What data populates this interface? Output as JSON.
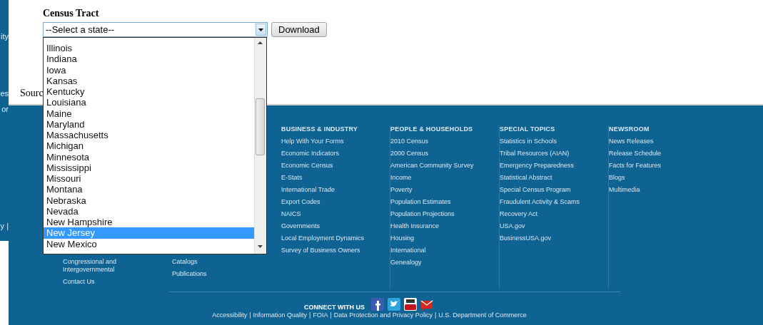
{
  "side_strip": [
    "ity",
    "es",
    "or",
    "y |"
  ],
  "heading": "Census Tract",
  "state_select": {
    "value": "--Select a state--",
    "expanded": true,
    "options": [
      {
        "label": "Illinois",
        "selected": false
      },
      {
        "label": "Indiana",
        "selected": false
      },
      {
        "label": "Iowa",
        "selected": false
      },
      {
        "label": "Kansas",
        "selected": false
      },
      {
        "label": "Kentucky",
        "selected": false
      },
      {
        "label": "Louisiana",
        "selected": false
      },
      {
        "label": "Maine",
        "selected": false
      },
      {
        "label": "Maryland",
        "selected": false
      },
      {
        "label": "Massachusetts",
        "selected": false
      },
      {
        "label": "Michigan",
        "selected": false
      },
      {
        "label": "Minnesota",
        "selected": false
      },
      {
        "label": "Mississippi",
        "selected": false
      },
      {
        "label": "Missouri",
        "selected": false
      },
      {
        "label": "Montana",
        "selected": false
      },
      {
        "label": "Nebraska",
        "selected": false
      },
      {
        "label": "Nevada",
        "selected": false
      },
      {
        "label": "New Hampshire",
        "selected": false
      },
      {
        "label": "New Jersey",
        "selected": true
      },
      {
        "label": "New Mexico",
        "selected": false
      }
    ]
  },
  "download_button": "Download",
  "source_label": "Sourc",
  "footer": {
    "columns": [
      {
        "links": [
          "Congressional and Intergovernmental",
          "Contact Us"
        ]
      },
      {
        "links": [
          "Catalogs",
          "Publications"
        ]
      },
      {
        "heading": "BUSINESS & INDUSTRY",
        "links": [
          "Help With Your Forms",
          "Economic Indicators",
          "Economic Census",
          "E-Stats",
          "International Trade",
          "Export Codes",
          "NAICS",
          "Governments",
          "Local Employment Dynamics",
          "Survey of Business Owners"
        ]
      },
      {
        "heading": "PEOPLE & HOUSEHOLDS",
        "links": [
          "2010 Census",
          "2000 Census",
          "American Community Survey",
          "Income",
          "Poverty",
          "Population Estimates",
          "Population Projections",
          "Health Insurance",
          "Housing",
          "International",
          "Genealogy"
        ]
      },
      {
        "heading": "SPECIAL TOPICS",
        "links": [
          "Statistics in Schools",
          "Tribal Resources (AIAN)",
          "Emergency Preparedness",
          "Statistical Abstract",
          "Special Census Program",
          "Fraudulent Activity & Scams",
          "Recovery Act",
          "USA.gov",
          "BusinessUSA.gov"
        ]
      },
      {
        "heading": "NEWSROOM",
        "links": [
          "News Releases",
          "Release Schedule",
          "Facts for Features",
          "Blogs",
          "Multimedia"
        ]
      }
    ],
    "connect_label": "CONNECT WITH US",
    "bottom_links": [
      "Accessibility",
      "Information Quality",
      "FOIA",
      "Data Protection and Privacy Policy",
      "U.S. Department of Commerce"
    ],
    "separator": "|"
  }
}
